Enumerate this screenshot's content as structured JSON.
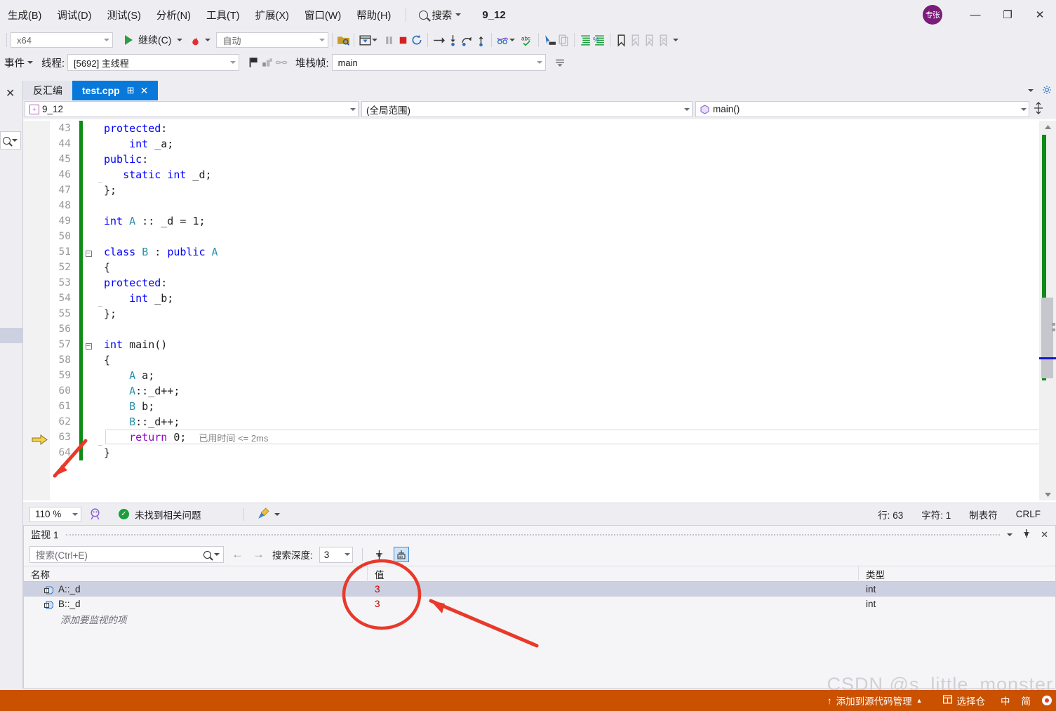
{
  "menu": {
    "items": [
      {
        "label": "生成(B)"
      },
      {
        "label": "调试(D)"
      },
      {
        "label": "测试(S)"
      },
      {
        "label": "分析(N)"
      },
      {
        "label": "工具(T)"
      },
      {
        "label": "扩展(X)"
      },
      {
        "label": "窗口(W)"
      },
      {
        "label": "帮助(H)"
      }
    ],
    "search_label": "搜索",
    "search_icon": "search-icon",
    "project_name": "9_12",
    "avatar_text": "专张",
    "window_buttons": {
      "minimize": "—",
      "restore": "❐",
      "close": "✕"
    }
  },
  "toolbar": {
    "platform": "x64",
    "continue_label": "继续(C)",
    "hot_reload_icon": "hot-reload-icon",
    "auto_mode": "自动",
    "icons": [
      "open-folder-search-icon",
      "show-next-statement-icon",
      "pause-icon",
      "stop-icon",
      "restart-icon",
      "step-over-arrow-icon",
      "step-into-icon",
      "step-over-icon",
      "step-out-icon",
      "thread-icon",
      "abc-check-icon",
      "pointer-icon",
      "copy-icon",
      "indent-icon",
      "comment-icon",
      "bookmark-icon",
      "prev-bookmark-icon",
      "next-bookmark-icon",
      "clear-bookmark-icon"
    ]
  },
  "debugbar": {
    "events_label": "事件",
    "thread_label": "线程:",
    "thread_value": "[5692] 主线程",
    "flag_icon": "flag-icon",
    "threads_icon": "threads-icon",
    "parallel_icon": "parallel-watch-icon",
    "stackframe_label": "堆栈帧:",
    "stackframe_value": "main"
  },
  "editor": {
    "tabs": [
      {
        "label": "反汇编",
        "active": false
      },
      {
        "label": "test.cpp",
        "active": true,
        "pin": "⊞",
        "close": "✕"
      }
    ],
    "nav": {
      "project": "9_12",
      "project_icon": "cpp-project-icon",
      "scope": "(全局范围)",
      "member": "main()",
      "member_icon": "method-icon",
      "split_icon": "split-view-icon"
    },
    "lines": [
      {
        "n": "43",
        "indent": 1,
        "tokens": [
          {
            "t": "protected",
            "c": "kw"
          },
          {
            "t": ":",
            "c": "id"
          }
        ],
        "fold": "",
        "guide": "solid"
      },
      {
        "n": "44",
        "indent": 2,
        "tokens": [
          {
            "t": "    ",
            "c": "id"
          },
          {
            "t": "int",
            "c": "kw"
          },
          {
            "t": " _a;",
            "c": "id"
          }
        ],
        "fold": "",
        "guide": "dashed"
      },
      {
        "n": "45",
        "indent": 1,
        "tokens": [
          {
            "t": "public",
            "c": "kw"
          },
          {
            "t": ":",
            "c": "id"
          }
        ],
        "fold": "",
        "guide": "solid"
      },
      {
        "n": "46",
        "indent": 2,
        "tokens": [
          {
            "t": "   ",
            "c": "id"
          },
          {
            "t": "static",
            "c": "kw"
          },
          {
            "t": " ",
            "c": "id"
          },
          {
            "t": "int",
            "c": "kw"
          },
          {
            "t": " _d;",
            "c": "id"
          }
        ],
        "fold": "",
        "guide": "dashed"
      },
      {
        "n": "47",
        "indent": 1,
        "tokens": [
          {
            "t": "};",
            "c": "id"
          }
        ],
        "fold": "",
        "guide": "end"
      },
      {
        "n": "48",
        "indent": 0,
        "tokens": [],
        "fold": "",
        "guide": "none"
      },
      {
        "n": "49",
        "indent": 1,
        "tokens": [
          {
            "t": "int",
            "c": "kw"
          },
          {
            "t": " ",
            "c": "id"
          },
          {
            "t": "A",
            "c": "typ"
          },
          {
            "t": " :: _d = ",
            "c": "id"
          },
          {
            "t": "1",
            "c": "num"
          },
          {
            "t": ";",
            "c": "id"
          }
        ],
        "fold": "",
        "guide": "none"
      },
      {
        "n": "50",
        "indent": 0,
        "tokens": [],
        "fold": "",
        "guide": "none"
      },
      {
        "n": "51",
        "indent": 0,
        "tokens": [
          {
            "t": "class",
            "c": "kw"
          },
          {
            "t": " ",
            "c": "id"
          },
          {
            "t": "B",
            "c": "typ"
          },
          {
            "t": " : ",
            "c": "id"
          },
          {
            "t": "public",
            "c": "kw"
          },
          {
            "t": " ",
            "c": "id"
          },
          {
            "t": "A",
            "c": "typ"
          }
        ],
        "fold": "minus",
        "guide": "none"
      },
      {
        "n": "52",
        "indent": 1,
        "tokens": [
          {
            "t": "{",
            "c": "id"
          }
        ],
        "fold": "",
        "guide": "solid"
      },
      {
        "n": "53",
        "indent": 1,
        "tokens": [
          {
            "t": "protected",
            "c": "kw"
          },
          {
            "t": ":",
            "c": "id"
          }
        ],
        "fold": "",
        "guide": "solid"
      },
      {
        "n": "54",
        "indent": 2,
        "tokens": [
          {
            "t": "    ",
            "c": "id"
          },
          {
            "t": "int",
            "c": "kw"
          },
          {
            "t": " _b;",
            "c": "id"
          }
        ],
        "fold": "",
        "guide": "dashed"
      },
      {
        "n": "55",
        "indent": 1,
        "tokens": [
          {
            "t": "};",
            "c": "id"
          }
        ],
        "fold": "",
        "guide": "end"
      },
      {
        "n": "56",
        "indent": 0,
        "tokens": [],
        "fold": "",
        "guide": "none"
      },
      {
        "n": "57",
        "indent": 0,
        "tokens": [
          {
            "t": "int",
            "c": "kw"
          },
          {
            "t": " ",
            "c": "id"
          },
          {
            "t": "main",
            "c": "id"
          },
          {
            "t": "()",
            "c": "id"
          }
        ],
        "fold": "minus",
        "guide": "none"
      },
      {
        "n": "58",
        "indent": 1,
        "tokens": [
          {
            "t": "{",
            "c": "id"
          }
        ],
        "fold": "",
        "guide": "solid"
      },
      {
        "n": "59",
        "indent": 2,
        "tokens": [
          {
            "t": "    ",
            "c": "id"
          },
          {
            "t": "A",
            "c": "typ"
          },
          {
            "t": " a;",
            "c": "id"
          }
        ],
        "fold": "",
        "guide": "dashed"
      },
      {
        "n": "60",
        "indent": 2,
        "tokens": [
          {
            "t": "    ",
            "c": "id"
          },
          {
            "t": "A",
            "c": "typ"
          },
          {
            "t": "::_d++;",
            "c": "id"
          }
        ],
        "fold": "",
        "guide": "dashed"
      },
      {
        "n": "61",
        "indent": 2,
        "tokens": [
          {
            "t": "    ",
            "c": "id"
          },
          {
            "t": "B",
            "c": "typ"
          },
          {
            "t": " b;",
            "c": "id"
          }
        ],
        "fold": "",
        "guide": "dashed"
      },
      {
        "n": "62",
        "indent": 2,
        "tokens": [
          {
            "t": "    ",
            "c": "id"
          },
          {
            "t": "B",
            "c": "typ"
          },
          {
            "t": "::_d++;",
            "c": "id"
          }
        ],
        "fold": "",
        "guide": "dashed"
      },
      {
        "n": "63",
        "indent": 2,
        "tokens": [
          {
            "t": "    ",
            "c": "id"
          },
          {
            "t": "return",
            "c": "kwret"
          },
          {
            "t": " ",
            "c": "id"
          },
          {
            "t": "0",
            "c": "num"
          },
          {
            "t": ";",
            "c": "id"
          }
        ],
        "fold": "",
        "guide": "dashed",
        "current": true,
        "annotation": "已用时间 <= 2ms"
      },
      {
        "n": "64",
        "indent": 1,
        "tokens": [
          {
            "t": "}",
            "c": "id"
          }
        ],
        "fold": "",
        "guide": "end"
      }
    ],
    "current_line_marker": "yellow-arrow-icon"
  },
  "editor_status": {
    "zoom": "110 %",
    "intellisense_icon": "intellisense-icon",
    "issues_text": "未找到相关问题",
    "issues_icon": "check-circle-icon",
    "broom_icon": "code-cleanup-icon",
    "line_label": "行: 63",
    "char_label": "字符: 1",
    "tab_label": "制表符",
    "eol_label": "CRLF"
  },
  "watch": {
    "title": "监视 1",
    "title_controls": [
      "dropdown-icon",
      "pin-icon",
      "close-icon"
    ],
    "search_placeholder": "搜索(Ctrl+E)",
    "search_icon": "search-icon",
    "nav_back": "←",
    "nav_forward": "→",
    "depth_label": "搜索深度:",
    "depth_value": "3",
    "pin_toggle_icon": "pin-toggle-icon",
    "hex_toggle_icon": "hex-display-icon",
    "columns": [
      "名称",
      "值",
      "类型"
    ],
    "rows": [
      {
        "name": "A::_d",
        "value": "3",
        "type": "int",
        "selected": true,
        "icon": "field-icon"
      },
      {
        "name": "B::_d",
        "value": "3",
        "type": "int",
        "selected": false,
        "icon": "field-icon"
      }
    ],
    "add_item_text": "添加要监视的项"
  },
  "bottom_status": {
    "source_control_label": "添加到源代码管理",
    "source_control_icon": "up-arrow-icon",
    "repo_label": "选择仓",
    "repo_icon": "repo-icon",
    "ime_cn": "中",
    "ime_simplified": "简"
  },
  "watermark": "CSDN @s_little_monster",
  "colors": {
    "accent_blue": "#0879da",
    "status_orange": "#ca5100",
    "changed_green": "#0e8a16",
    "keyword_blue": "#0000ff",
    "type_teal": "#2b91af",
    "value_red": "#c00000",
    "annotation_red": "#e8392a"
  }
}
